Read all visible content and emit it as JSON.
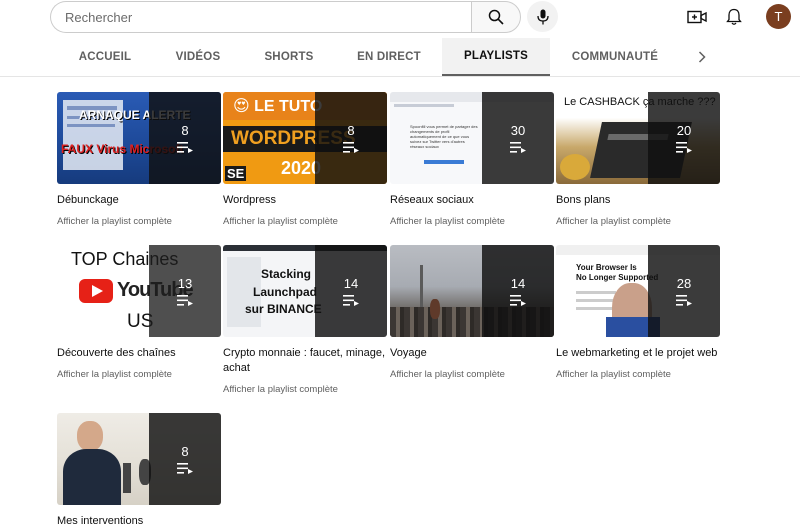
{
  "search": {
    "placeholder": "Rechercher"
  },
  "header": {
    "avatar_letter": "T"
  },
  "tabs": [
    {
      "label": "ACCUEIL"
    },
    {
      "label": "VIDÉOS"
    },
    {
      "label": "SHORTS"
    },
    {
      "label": "EN DIRECT"
    },
    {
      "label": "PLAYLISTS"
    },
    {
      "label": "COMMUNAUTÉ"
    }
  ],
  "playlist_link_label": "Afficher la playlist complète",
  "playlists": [
    {
      "title": "Débunckage",
      "count": "8",
      "thumb_text_1": "ARNAQUE ALERTE",
      "thumb_text_2": "FAUX Virus Microsoft"
    },
    {
      "title": "Wordpress",
      "count": "8",
      "thumb_text_1": "😍 LE TUTO",
      "thumb_text_2": "WORDPRESS",
      "thumb_text_3": "2020",
      "thumb_text_4": "SE"
    },
    {
      "title": "Réseaux sociaux",
      "count": "30",
      "thumb_text_1": "Spoonfill vous permet de partager des changements de profil automatiquement de ce que vous suivez sur Twitter vers d'autres réseaux sociaux"
    },
    {
      "title": "Bons plans",
      "count": "20",
      "thumb_text_1": "Le CASHBACK ça marche ???"
    },
    {
      "title": "Découverte des chaînes",
      "count": "13",
      "thumb_text_1": "TOP Chaines",
      "thumb_text_2": "YouTube",
      "thumb_text_3": "US"
    },
    {
      "title": "Crypto monnaie : faucet, minage, achat",
      "count": "14",
      "thumb_text_1": "Stacking",
      "thumb_text_2": "Launchpad",
      "thumb_text_3": "sur BINANCE"
    },
    {
      "title": "Voyage",
      "count": "14"
    },
    {
      "title": "Le webmarketing et le projet web",
      "count": "28",
      "thumb_text_1": "Your Browser Is",
      "thumb_text_2": "No Longer Supported"
    },
    {
      "title": "Mes interventions",
      "count": "8"
    }
  ]
}
